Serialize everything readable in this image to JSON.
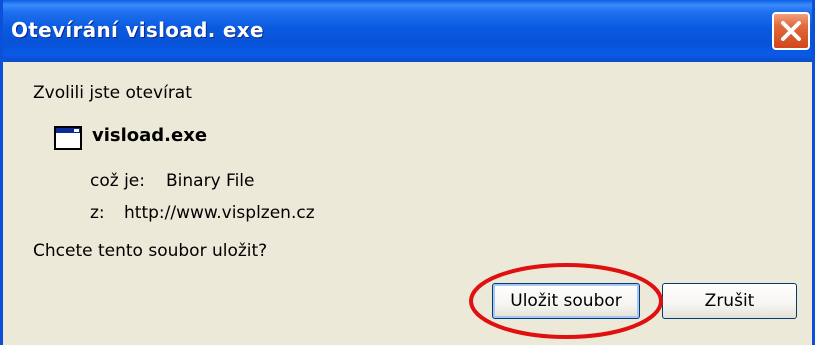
{
  "dialog": {
    "title": "Otevírání visload. exe",
    "intro": "Zvolili jste otevírat",
    "file_name": "visload.exe",
    "type_label": "což je:",
    "type_value": "Binary File",
    "source_label": "z:",
    "source_value": "http://www.visplzen.cz",
    "question": "Chcete tento soubor uložit?"
  },
  "buttons": {
    "save_label": "Uložit soubor",
    "cancel_label": "Zrušit"
  },
  "icons": {
    "close": "close-icon",
    "file": "application-window-icon"
  },
  "colors": {
    "titlebar": "#0a5ae0",
    "close_button": "#d2461c",
    "dialog_background": "#ece9d8",
    "highlight": "#e01010"
  }
}
